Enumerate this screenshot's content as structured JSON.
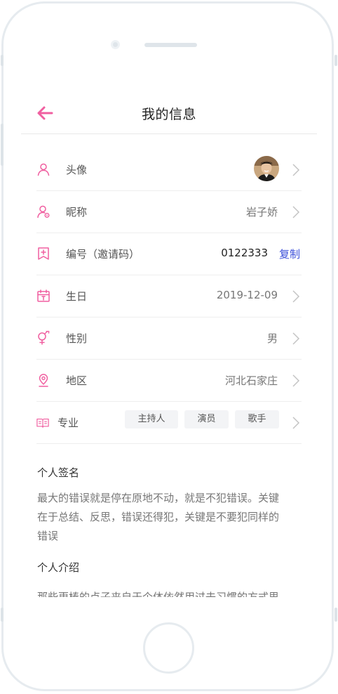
{
  "header": {
    "title": "我的信息"
  },
  "rows": {
    "avatar": {
      "label": "头像"
    },
    "nickname": {
      "label": "昵称",
      "value": "岩子娇"
    },
    "id": {
      "label": "编号（邀请码）",
      "value": "0122333",
      "copy_label": "复制"
    },
    "birthday": {
      "label": "生日",
      "value": "2019-12-09"
    },
    "gender": {
      "label": "性别",
      "value": "男"
    },
    "region": {
      "label": "地区",
      "value": "河北石家庄"
    },
    "major": {
      "label": "专业",
      "tags": [
        "主持人",
        "演员",
        "歌手"
      ]
    }
  },
  "signature": {
    "title": "个人签名",
    "lines": [
      "最大的错误就是停在原地不动，就是不犯错误。关键",
      "在于总结、反思，错误还得犯，关键是不要犯同样的",
      "错误"
    ]
  },
  "intro": {
    "title": "个人介绍",
    "text": "那些更棒的点子来自于个体依然用过去习惯的方式思"
  },
  "colors": {
    "accent": "#f05fa0",
    "link": "#3b4fd9"
  },
  "icons": [
    "back-arrow-icon",
    "user-icon",
    "user-settings-icon",
    "bookmark-plus-icon",
    "calendar-icon",
    "gender-icon",
    "location-pin-icon",
    "book-icon",
    "chevron-right-icon"
  ]
}
